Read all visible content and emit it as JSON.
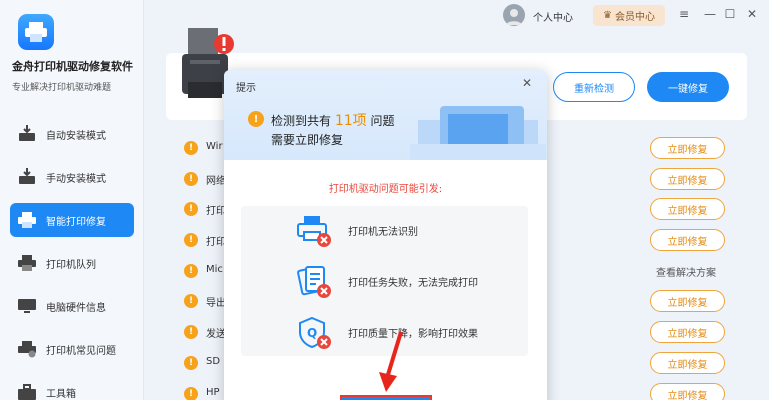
{
  "app": {
    "title": "金舟打印机驱动修复软件",
    "subtitle": "专业解决打印机驱动难题"
  },
  "sidebar": {
    "items": [
      {
        "label": "自动安装模式",
        "icon": "auto-install-icon",
        "active": false
      },
      {
        "label": "手动安装模式",
        "icon": "manual-install-icon",
        "active": false
      },
      {
        "label": "智能打印修复",
        "icon": "smart-repair-icon",
        "active": true
      },
      {
        "label": "打印机队列",
        "icon": "printer-queue-icon",
        "active": false
      },
      {
        "label": "电脑硬件信息",
        "icon": "hardware-info-icon",
        "active": false
      },
      {
        "label": "打印机常见问题",
        "icon": "faq-icon",
        "active": false
      },
      {
        "label": "工具箱",
        "icon": "toolbox-icon",
        "active": false
      }
    ]
  },
  "topbar": {
    "user_center": "个人中心",
    "vip": "会员中心",
    "menu_icon": "≡",
    "min_icon": "—",
    "max_icon": "☐",
    "close_icon": "✕"
  },
  "card": {
    "rescan": "重新检测",
    "fix_all": "一键修复"
  },
  "rows": [
    {
      "text": "Wir",
      "action": "立即修复"
    },
    {
      "text": "网络",
      "action": "立即修复"
    },
    {
      "text": "打印",
      "action": "立即修复"
    },
    {
      "text": "打印",
      "action": "立即修复"
    },
    {
      "text": "Mic",
      "action": "查看解决方案"
    },
    {
      "text": "导出",
      "action": "立即修复"
    },
    {
      "text": "发送",
      "action": "立即修复"
    },
    {
      "text": "SD",
      "action": "立即修复"
    },
    {
      "text": "HP",
      "action": "立即修复"
    }
  ],
  "modal": {
    "title": "提示",
    "close": "✕",
    "line1_prefix": "检测到共有",
    "count": "11项",
    "line1_suffix": "问题",
    "line2": "需要立即修复",
    "cause_title": "打印机驱动问题可能引发:",
    "causes": [
      "打印机无法识别",
      "打印任务失败，无法完成打印",
      "打印质量下降，影响打印效果"
    ]
  },
  "colors": {
    "accent": "#1e88f5",
    "warning": "#f7a21b",
    "danger": "#e8473e"
  }
}
